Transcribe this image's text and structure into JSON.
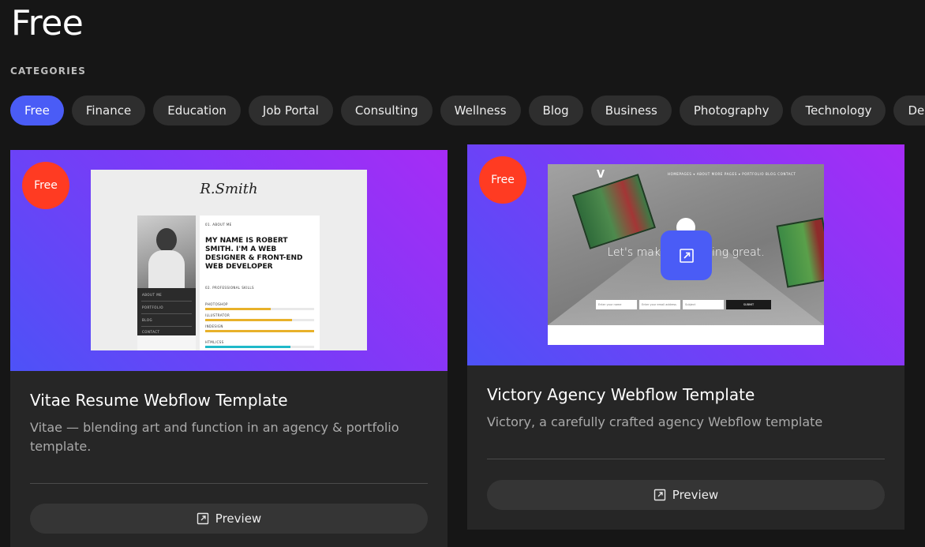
{
  "page": {
    "title": "Free",
    "categories_label": "CATEGORIES"
  },
  "categories": [
    {
      "label": "Free",
      "active": true
    },
    {
      "label": "Finance"
    },
    {
      "label": "Education"
    },
    {
      "label": "Job Portal"
    },
    {
      "label": "Consulting"
    },
    {
      "label": "Wellness"
    },
    {
      "label": "Blog"
    },
    {
      "label": "Business"
    },
    {
      "label": "Photography"
    },
    {
      "label": "Technology"
    },
    {
      "label": "Design"
    }
  ],
  "colors": {
    "accent": "#4a5cf6",
    "badge": "#ff3b22",
    "card_bg": "#262626",
    "page_bg": "#161616"
  },
  "cards": [
    {
      "badge": "Free",
      "title": "Vitae Resume Webflow Template",
      "description": "Vitae — blending art and function in an agency & portfolio template.",
      "preview_label": "Preview",
      "preview_icon": "external-link-icon",
      "thumbnail": {
        "signature": "R.Smith",
        "menu": [
          "ABOUT ME",
          "PORTFOLIO",
          "BLOG",
          "CONTACT"
        ],
        "section_about": "01. ABOUT ME",
        "headline": "MY NAME IS ROBERT SMITH. I'M A WEB DESIGNER & FRONT-END WEB DEVELOPER",
        "section_skills": "02. PROFESSIONAL SKILLS",
        "skills": [
          {
            "name": "PHOTOSHOP",
            "level": 0.6
          },
          {
            "name": "ILLUSTRATOR",
            "level": 0.8
          },
          {
            "name": "INDESIGN",
            "level": 1.0
          },
          {
            "name": "HTML/CSS",
            "level": 0.78
          }
        ]
      }
    },
    {
      "badge": "Free",
      "title": "Victory Agency Webflow Template",
      "description": "Victory, a carefully crafted agency Webflow template",
      "preview_label": "Preview",
      "preview_icon": "external-link-icon",
      "thumbnail": {
        "logo": "V",
        "nav": "HOMEPAGES ▾   ABOUT   MORE PAGES ▾   PORTFOLIO   BLOG   CONTACT",
        "hero_text": "Let's make something great.",
        "fields": [
          "Enter your name",
          "Enter your email address",
          "Subject"
        ],
        "submit": "SUBMIT"
      }
    }
  ]
}
